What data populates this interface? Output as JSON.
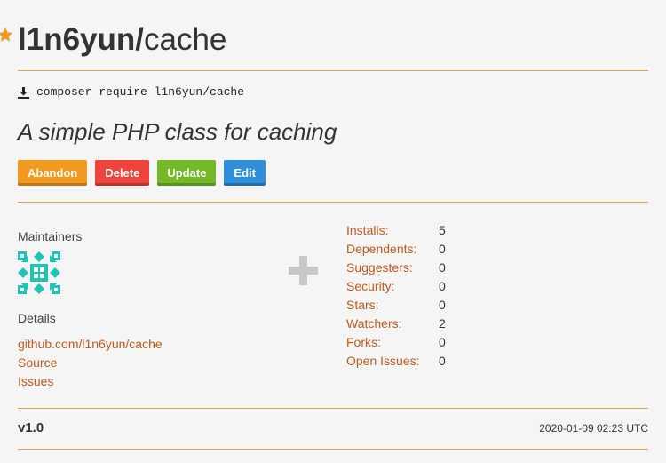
{
  "package": {
    "vendor": "l1n6yun/",
    "name": "cache",
    "install_command": "composer require l1n6yun/cache",
    "description": "A simple PHP class for caching"
  },
  "actions": {
    "abandon": "Abandon",
    "delete": "Delete",
    "update": "Update",
    "edit": "Edit"
  },
  "maintainers": {
    "label": "Maintainers"
  },
  "details": {
    "label": "Details",
    "links": [
      "github.com/l1n6yun/cache",
      "Source",
      "Issues"
    ]
  },
  "stats": [
    {
      "label": "Installs:",
      "value": "5"
    },
    {
      "label": "Dependents:",
      "value": "0"
    },
    {
      "label": "Suggesters:",
      "value": "0"
    },
    {
      "label": "Security:",
      "value": "0"
    },
    {
      "label": "Stars:",
      "value": "0"
    },
    {
      "label": "Watchers:",
      "value": "2"
    },
    {
      "label": "Forks:",
      "value": "0"
    },
    {
      "label": "Open Issues:",
      "value": "0"
    }
  ],
  "version": {
    "name": "v1.0",
    "date": "2020-01-09 02:23 UTC"
  },
  "colors": {
    "accent": "#c05a1d",
    "divider": "#d9a44a",
    "star": "#f39a1e",
    "avatar": "#1fc4b4"
  },
  "icons": {
    "star": "star-icon",
    "download": "download-icon",
    "plus": "plus-icon"
  }
}
